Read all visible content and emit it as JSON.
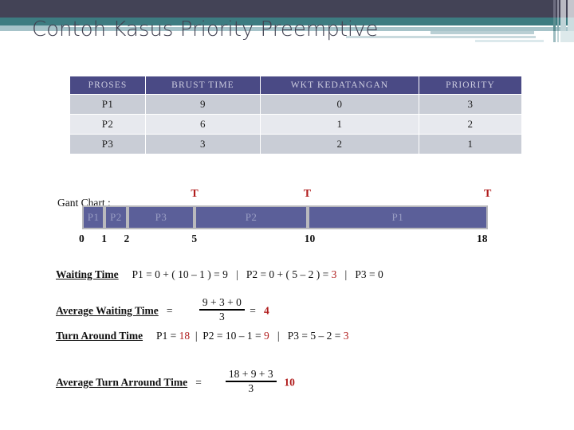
{
  "slide": {
    "title": "Contoh Kasus Priority Preemptive",
    "accent_dark": "#434356",
    "accent_teal": "#3d7c81",
    "accent_light": "#a6c3c9",
    "highlight_red": "#b01c1c"
  },
  "table": {
    "headers": [
      "PROSES",
      "BRUST TIME",
      "WKT KEDATANGAN",
      "PRIORITY"
    ],
    "rows": [
      [
        "P1",
        "9",
        "0",
        "3"
      ],
      [
        "P2",
        "6",
        "1",
        "2"
      ],
      [
        "P3",
        "3",
        "2",
        "1"
      ]
    ]
  },
  "gantt": {
    "label": "Gant Chart :",
    "segments": [
      {
        "name": "P1",
        "start": 0,
        "end": 1
      },
      {
        "name": "P2",
        "start": 1,
        "end": 2
      },
      {
        "name": "P3",
        "start": 2,
        "end": 5
      },
      {
        "name": "P2",
        "start": 5,
        "end": 10
      },
      {
        "name": "P1",
        "start": 10,
        "end": 18
      }
    ],
    "ticks": [
      "0",
      "1",
      "2",
      "5",
      "10",
      "18"
    ],
    "tick_values": [
      0,
      1,
      2,
      5,
      10,
      18
    ],
    "markers": [
      {
        "label": "T",
        "at": 5
      },
      {
        "label": "T",
        "at": 10
      },
      {
        "label": "T",
        "at": 18
      }
    ],
    "marker_label": "T"
  },
  "formulas": {
    "waiting_time": {
      "label": "Waiting Time",
      "p1": "P1 = 0 + ( 10 – 1 ) = 9",
      "sep1": "|",
      "p2_pre": "P2 = 0 + ( 5 – 2 ) = ",
      "p2_val": "3",
      "sep2": "|",
      "p3": "P3 = 0"
    },
    "average_waiting_time": {
      "label": "Average Waiting Time",
      "equals": "=",
      "numerator": "9 + 3 + 0",
      "denominator": "3",
      "equals2": "=",
      "result": "4"
    },
    "turn_around_time": {
      "label": "Turn Around Time",
      "p1_pre": "P1  =  ",
      "p1_val": "18",
      "sep1": "|",
      "p2_pre": "P2  =  10 – 1  =  ",
      "p2_val": "9",
      "sep2": "|",
      "p3_pre": "P3  =  5 – 2  =  ",
      "p3_val": "3"
    },
    "average_turn_around_time": {
      "label": "Average Turn Arround Time",
      "equals": "=",
      "numerator": "18 + 9 + 3",
      "denominator": "3",
      "result": "10"
    }
  }
}
